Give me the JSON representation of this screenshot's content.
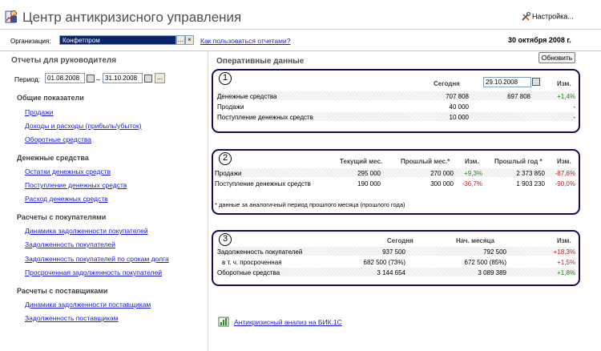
{
  "header": {
    "title": "Центр антикризисного управления",
    "settings_label": "Настройка...",
    "organization_label": "Организация:",
    "organization_value": "Конфетпром",
    "help_link": "Как пользоваться отчетами?",
    "current_date": "30 октября 2008 г."
  },
  "left": {
    "heading": "Отчеты для руководителя",
    "period_label": "Период:",
    "period_from": "01.08.2008",
    "period_dash": "–",
    "period_to": "31.10.2008",
    "period_more": "...",
    "sections": [
      {
        "title": "Общие показатели",
        "items": [
          "Продажи",
          "Доходы и расходы (прибыль/убыток)",
          "Оборотные средства"
        ]
      },
      {
        "title": "Денежные средства",
        "items": [
          "Остатки денежных средств",
          "Поступление денежных средств",
          "Расход денежных средств"
        ]
      },
      {
        "title": "Расчеты с покупателями",
        "items": [
          "Динамика задолженности покупателей",
          "Задолженность покупателей",
          "Задолженность покупателей по срокам долга",
          "Просроченная задолженность покупателей"
        ]
      },
      {
        "title": "Расчеты с поставщиками",
        "items": [
          "Динамика задолженности поставщикам",
          "Задолженность поставщикам"
        ]
      }
    ]
  },
  "right": {
    "heading": "Оперативные данные",
    "refresh_label": "Обновить",
    "panel1": {
      "number": "1",
      "col_today": "Сегодня",
      "col_date": "29.10.2008",
      "col_change": "Изм.",
      "rows": [
        {
          "label": "Денежные средства",
          "today": "707 808",
          "date": "697 808",
          "change": "+1,4%"
        },
        {
          "label": "Продажи",
          "today": "40 000",
          "date": "",
          "change": "-"
        },
        {
          "label": "Поступление денежных средств",
          "today": "10 000",
          "date": "",
          "change": "-"
        }
      ]
    },
    "panel2": {
      "number": "2",
      "col_current": "Текущий мес.",
      "col_prev": "Прошлый мес.*",
      "col_change1": "Изм.",
      "col_prevyear": "Прошлый год *",
      "col_change2": "Изм.",
      "rows": [
        {
          "label": "Продажи",
          "current": "295 000",
          "prev": "270 000",
          "change1": "+9,3%",
          "prevyear": "2 373 850",
          "change2": "-87,6%"
        },
        {
          "label": "Поступление денежных средств",
          "current": "190 000",
          "prev": "300 000",
          "change1": "-36,7%",
          "prevyear": "1 903 230",
          "change2": "-90,0%"
        }
      ],
      "footnote": "* данные за аналогичный период прошлого месяца (прошлого года)"
    },
    "panel3": {
      "number": "3",
      "col_today": "Сегодня",
      "col_month_start": "Нач. месяца",
      "col_change": "Изм.",
      "rows": [
        {
          "label": "Задолженность покупателей",
          "today": "937 500",
          "start": "792 500",
          "change": "+18,3%"
        },
        {
          "label": "в т. ч. просроченная",
          "today": "682 500 (73%)",
          "start": "672 500 (85%)",
          "change": "+1,5%"
        },
        {
          "label": "Оборотные средства",
          "today": "3 144 654",
          "start": "3 089 389",
          "change": "+1,8%"
        }
      ]
    },
    "analysis_link": "Антикризисный анализ на БИК.1С"
  },
  "colors": {
    "positive": "#1f8a1f",
    "negative": "#c22020",
    "link": "#1a1ad6",
    "panel_border": "#10105a"
  }
}
